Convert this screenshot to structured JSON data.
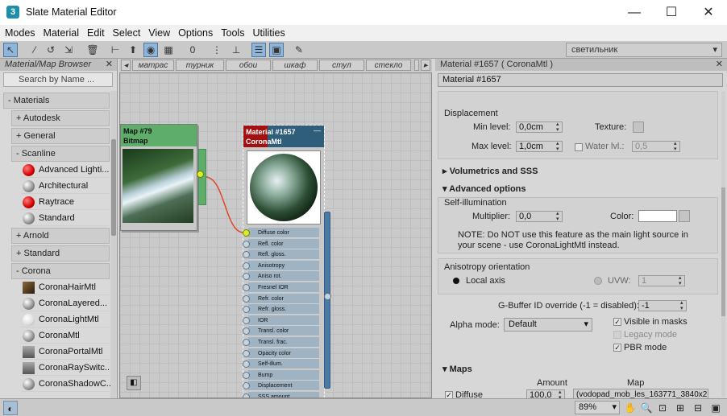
{
  "window": {
    "title": "Slate Material Editor",
    "app_icon": "3"
  },
  "menu": [
    "Modes",
    "Material",
    "Edit",
    "Select",
    "View",
    "Options",
    "Tools",
    "Utilities"
  ],
  "toolbar": {
    "view_selector": "светильник"
  },
  "browser": {
    "title": "Material/Map Browser",
    "search_placeholder": "Search by Name ...",
    "root": "- Materials",
    "groups": {
      "autodesk": "+ Autodesk",
      "general": "+ General",
      "scanline": "- Scanline",
      "arnold": "+ Arnold",
      "standard": "+ Standard",
      "corona": "- Corona"
    },
    "scanline_items": [
      "Advanced Lighti...",
      "Architectural",
      "Raytrace",
      "Standard"
    ],
    "corona_items": [
      "CoronaHairMtl",
      "CoronaLayered...",
      "CoronaLightMtl",
      "CoronaMtl",
      "CoronaPortalMtl",
      "CoronaRaySwitc...",
      "CoronaShadowC..."
    ]
  },
  "view_tabs": [
    "матрас",
    "турник",
    "обои",
    "шкаф",
    "стул",
    "стекло"
  ],
  "map_node": {
    "title": "Map #79",
    "type": "Bitmap"
  },
  "material_node": {
    "title": "Material #1657",
    "type": "CoronaMtl",
    "slots": [
      "Diffuse color",
      "Refl. color",
      "Refl. gloss.",
      "Anisotropy",
      "Aniso rot.",
      "Fresnel IOR",
      "Refr. color",
      "Refr. gloss.",
      "IOR",
      "Transl. color",
      "Transl. frac.",
      "Opacity color",
      "Self-illum.",
      "Bump",
      "Displacement",
      "SSS amount"
    ]
  },
  "params": {
    "title": "Material #1657  ( CoronaMtl )",
    "name": "Material #1657",
    "displacement": {
      "label": "Displacement",
      "min_label": "Min level:",
      "min_value": "0,0cm",
      "max_label": "Max level:",
      "max_value": "1,0cm",
      "texture_label": "Texture:",
      "water_label": "Water lvl.:",
      "water_value": "0,5"
    },
    "volumetrics": "Volumetrics and SSS",
    "advanced": "Advanced options",
    "self_illum": {
      "label": "Self-illumination",
      "multiplier_label": "Multiplier:",
      "multiplier_value": "0,0",
      "color_label": "Color:",
      "note": "NOTE: Do NOT use this feature as the main light source in your scene - use CoronaLightMtl instead."
    },
    "anisotropy": {
      "label": "Anisotropy orientation",
      "local_axis": "Local axis",
      "uvw_label": "UVW:",
      "uvw_value": "1"
    },
    "gbuffer_label": "G-Buffer ID override (-1 = disabled):",
    "gbuffer_value": "-1",
    "alpha_label": "Alpha mode:",
    "alpha_value": "Default",
    "visible_in_masks": "Visible in masks",
    "legacy_mode": "Legacy mode",
    "pbr_mode": "PBR mode",
    "maps": {
      "title": "Maps",
      "col_amount": "Amount",
      "col_map": "Map",
      "row_label": "Diffuse",
      "row_amount": "100,0",
      "row_map": "(vodopad_mob_les_163771_3840x2"
    }
  },
  "status": {
    "zoom": "89%"
  },
  "colors": {
    "accent_blue": "#8fb6d8",
    "bitmap_node": "#5fad6b",
    "material_header": "#a21010",
    "link_wire": "#e0472a"
  }
}
